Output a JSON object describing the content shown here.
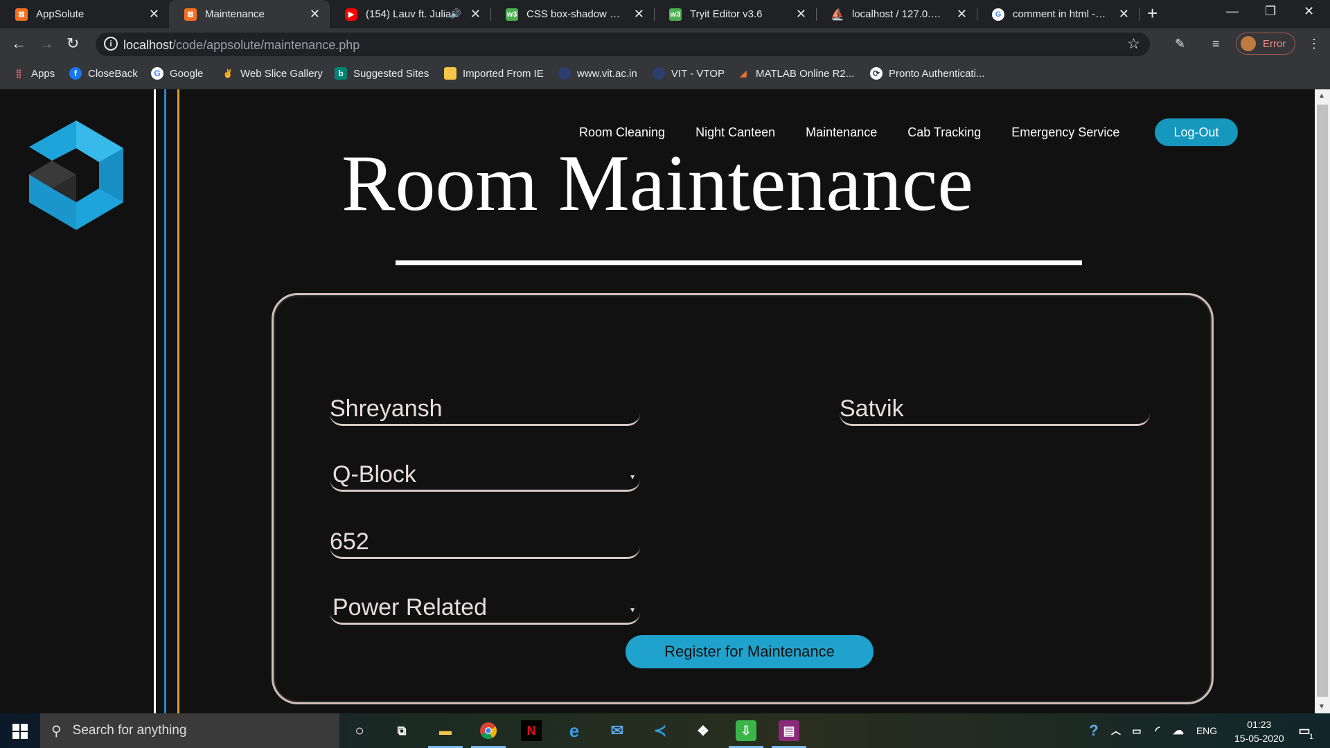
{
  "browser": {
    "tabs": [
      {
        "title": "AppSolute",
        "favicon": "xampp-icon",
        "active": false
      },
      {
        "title": "Maintenance",
        "favicon": "xampp-icon",
        "active": true
      },
      {
        "title": "(154) Lauv ft. Julia",
        "favicon": "youtube-icon",
        "active": false,
        "audio": true
      },
      {
        "title": "CSS box-shadow prope",
        "favicon": "w3schools-icon",
        "active": false
      },
      {
        "title": "Tryit Editor v3.6",
        "favicon": "w3schools-icon",
        "active": false
      },
      {
        "title": "localhost / 127.0.0.1 / s",
        "favicon": "phpmyadmin-icon",
        "active": false
      },
      {
        "title": "comment in html - Goo",
        "favicon": "google-icon",
        "active": false
      }
    ],
    "url_host": "localhost",
    "url_path": "/code/appsolute/maintenance.php",
    "profile_label": "Error",
    "bookmarks": [
      {
        "label": "Apps",
        "icon": "apps-grid-icon"
      },
      {
        "label": "CloseBack",
        "icon": "facebook-icon"
      },
      {
        "label": "Google",
        "icon": "google-icon"
      },
      {
        "label": "Web Slice Gallery",
        "icon": "web-slice-icon"
      },
      {
        "label": "Suggested Sites",
        "icon": "bing-icon"
      },
      {
        "label": "Imported From IE",
        "icon": "folder-icon"
      },
      {
        "label": "www.vit.ac.in",
        "icon": "vit-icon"
      },
      {
        "label": "VIT - VTOP",
        "icon": "vit-icon"
      },
      {
        "label": "MATLAB Online R2...",
        "icon": "matlab-icon"
      },
      {
        "label": "Pronto Authenticati...",
        "icon": "pronto-icon"
      }
    ]
  },
  "site": {
    "nav": [
      "Room Cleaning",
      "Night Canteen",
      "Maintenance",
      "Cab Tracking",
      "Emergency Service"
    ],
    "logout_label": "Log-Out",
    "title": "Room Maintenance",
    "form": {
      "first_name": "Shreyansh",
      "last_name": "Satvik",
      "block": "Q-Block",
      "room": "652",
      "issue": "Power Related",
      "submit_label": "Register for Maintenance"
    },
    "colors": {
      "accent": "#1597be",
      "background": "#111111",
      "stripe_blue": "#2f86c9",
      "stripe_orange": "#e89a30"
    }
  },
  "taskbar": {
    "search_placeholder": "Search for anything",
    "apps": [
      "cortana-icon",
      "task-view-icon",
      "file-explorer-icon",
      "chrome-icon",
      "netflix-icon",
      "edge-icon",
      "mail-icon",
      "vscode-icon",
      "dropbox-icon",
      "cloud-download-icon",
      "winrar-icon"
    ],
    "language": "ENG",
    "time": "01:23",
    "date": "15-05-2020",
    "notifications": "1"
  }
}
